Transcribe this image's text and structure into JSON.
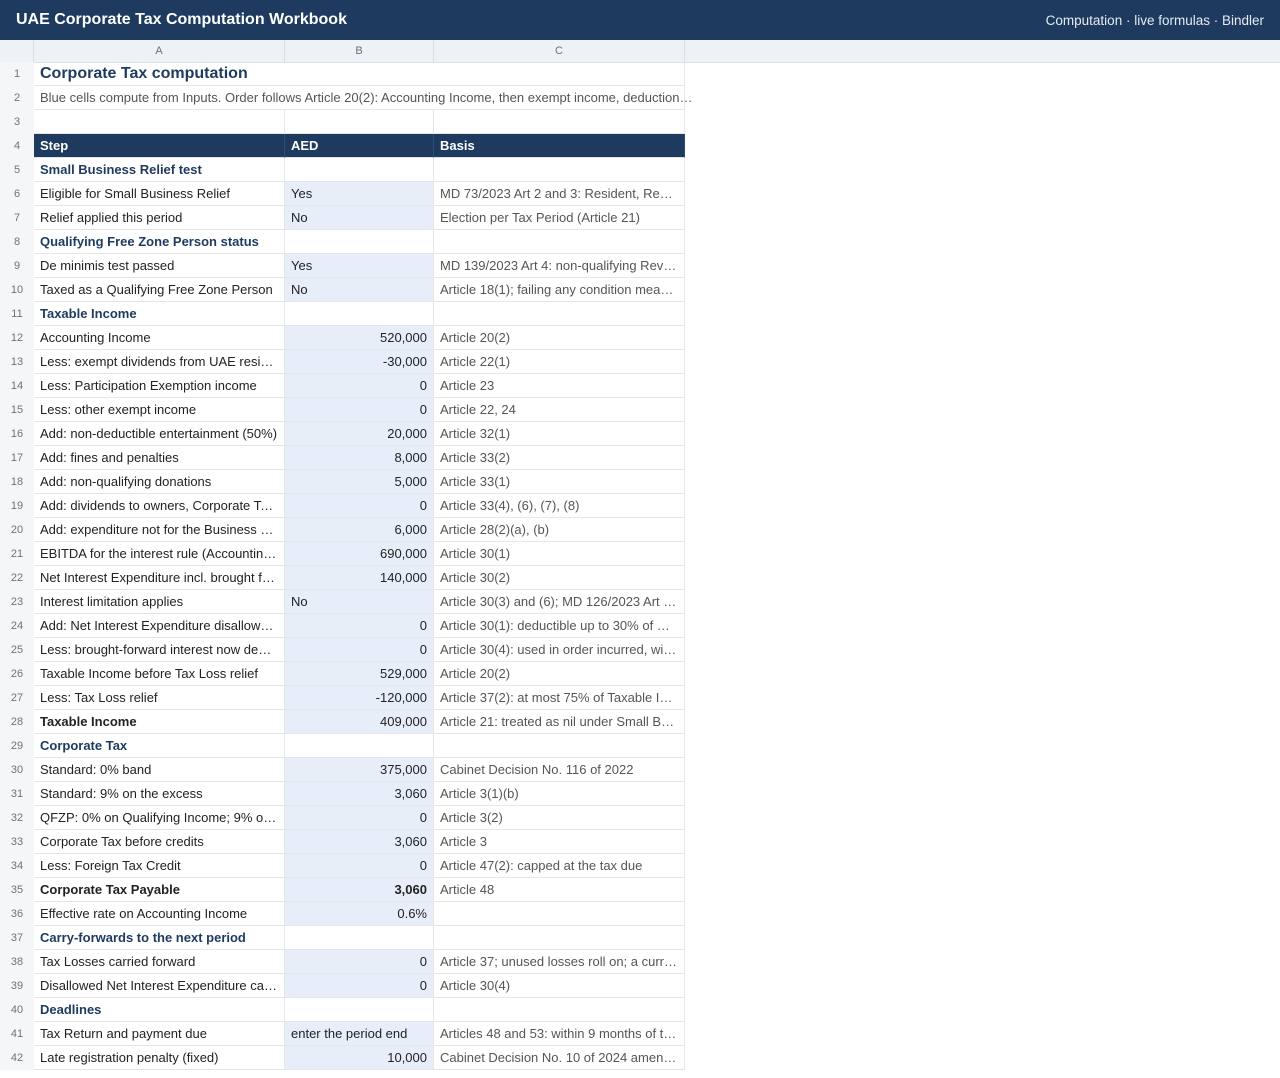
{
  "app": {
    "title": "UAE Corporate Tax Computation Workbook",
    "meta": "Computation · live formulas · Bindler"
  },
  "columns": [
    "A",
    "B",
    "C"
  ],
  "sheet": {
    "title": "Corporate Tax computation",
    "subtitle": "Blue cells compute from Inputs. Order follows Article 20(2): Accounting Income, then exempt income, deduction…",
    "header": {
      "step": "Step",
      "aed": "AED",
      "basis": "Basis"
    }
  },
  "rows": [
    {
      "n": "1",
      "kind": "title"
    },
    {
      "n": "2",
      "kind": "sub"
    },
    {
      "n": "3",
      "kind": "blank"
    },
    {
      "n": "4",
      "kind": "header"
    },
    {
      "n": "5",
      "kind": "section",
      "a": "Small Business Relief test"
    },
    {
      "n": "6",
      "kind": "data",
      "a": "Eligible for Small Business Relief",
      "b": "Yes",
      "c": "MD 73/2023 Art 2 and 3: Resident, Reve…"
    },
    {
      "n": "7",
      "kind": "data",
      "a": "Relief applied this period",
      "b": "No",
      "c": "Election per Tax Period (Article 21)"
    },
    {
      "n": "8",
      "kind": "section",
      "a": "Qualifying Free Zone Person status"
    },
    {
      "n": "9",
      "kind": "data",
      "a": "De minimis test passed",
      "b": "Yes",
      "c": "MD 139/2023 Art 4: non-qualifying Reve…"
    },
    {
      "n": "10",
      "kind": "data",
      "a": "Taxed as a Qualifying Free Zone Person",
      "b": "No",
      "c": "Article 18(1); failing any condition means…"
    },
    {
      "n": "11",
      "kind": "section",
      "a": "Taxable Income"
    },
    {
      "n": "12",
      "kind": "num",
      "a": "Accounting Income",
      "b": "520,000",
      "c": "Article 20(2)"
    },
    {
      "n": "13",
      "kind": "num",
      "a": "Less: exempt dividends from UAE resid…",
      "b": "-30,000",
      "c": "Article 22(1)"
    },
    {
      "n": "14",
      "kind": "num",
      "a": "Less: Participation Exemption income",
      "b": "0",
      "c": "Article 23"
    },
    {
      "n": "15",
      "kind": "num",
      "a": "Less: other exempt income",
      "b": "0",
      "c": "Article 22, 24"
    },
    {
      "n": "16",
      "kind": "num",
      "a": "Add: non-deductible entertainment (50%)",
      "b": "20,000",
      "c": "Article 32(1)"
    },
    {
      "n": "17",
      "kind": "num",
      "a": "Add: fines and penalties",
      "b": "8,000",
      "c": "Article 33(2)"
    },
    {
      "n": "18",
      "kind": "num",
      "a": "Add: non-qualifying donations",
      "b": "5,000",
      "c": "Article 33(1)"
    },
    {
      "n": "19",
      "kind": "num",
      "a": "Add: dividends to owners, Corporate Ta…",
      "b": "0",
      "c": "Article 33(4), (6), (7), (8)"
    },
    {
      "n": "20",
      "kind": "num",
      "a": "Add: expenditure not for the Business or…",
      "b": "6,000",
      "c": "Article 28(2)(a), (b)"
    },
    {
      "n": "21",
      "kind": "num",
      "a": "EBITDA for the interest rule (Accounting …",
      "b": "690,000",
      "c": "Article 30(1)"
    },
    {
      "n": "22",
      "kind": "num",
      "a": "Net Interest Expenditure incl. brought for…",
      "b": "140,000",
      "c": "Article 30(2)"
    },
    {
      "n": "23",
      "kind": "data",
      "a": "Interest limitation applies",
      "b": "No",
      "c": "Article 30(3) and (6); MD 126/2023 Art 8:…"
    },
    {
      "n": "24",
      "kind": "num",
      "a": "Add: Net Interest Expenditure disallowe…",
      "b": "0",
      "c": "Article 30(1): deductible up to 30% of E…"
    },
    {
      "n": "25",
      "kind": "num",
      "a": "Less: brought-forward interest now ded…",
      "b": "0",
      "c": "Article 30(4): used in order incurred, with…"
    },
    {
      "n": "26",
      "kind": "num",
      "a": "Taxable Income before Tax Loss relief",
      "b": "529,000",
      "c": "Article 20(2)"
    },
    {
      "n": "27",
      "kind": "num",
      "a": "Less: Tax Loss relief",
      "b": "-120,000",
      "c": "Article 37(2): at most 75% of Taxable Inc…"
    },
    {
      "n": "28",
      "kind": "num",
      "bold_a": true,
      "a": "Taxable Income",
      "b": "409,000",
      "c": "Article 21: treated as nil under Small Bu…"
    },
    {
      "n": "29",
      "kind": "section",
      "a": "Corporate Tax"
    },
    {
      "n": "30",
      "kind": "num",
      "a": "Standard: 0% band",
      "b": "375,000",
      "c": "Cabinet Decision No. 116 of 2022"
    },
    {
      "n": "31",
      "kind": "num",
      "a": "Standard: 9% on the excess",
      "b": "3,060",
      "c": "Article 3(1)(b)"
    },
    {
      "n": "32",
      "kind": "num",
      "a": "QFZP: 0% on Qualifying Income; 9% on…",
      "b": "0",
      "c": "Article 3(2)"
    },
    {
      "n": "33",
      "kind": "num",
      "a": "Corporate Tax before credits",
      "b": "3,060",
      "c": "Article 3"
    },
    {
      "n": "34",
      "kind": "num",
      "a": "Less: Foreign Tax Credit",
      "b": "0",
      "c": "Article 47(2): capped at the tax due"
    },
    {
      "n": "35",
      "kind": "num",
      "bold_a": true,
      "bold_b": true,
      "a": "Corporate Tax Payable",
      "b": "3,060",
      "c": "Article 48"
    },
    {
      "n": "36",
      "kind": "num",
      "a": "Effective rate on Accounting Income",
      "b": "0.6%",
      "c": ""
    },
    {
      "n": "37",
      "kind": "section",
      "a": "Carry-forwards to the next period"
    },
    {
      "n": "38",
      "kind": "num",
      "a": "Tax Losses carried forward",
      "b": "0",
      "c": "Article 37; unused losses roll on; a curre…"
    },
    {
      "n": "39",
      "kind": "num",
      "a": "Disallowed Net Interest Expenditure carr…",
      "b": "0",
      "c": "Article 30(4)"
    },
    {
      "n": "40",
      "kind": "section",
      "a": "Deadlines"
    },
    {
      "n": "41",
      "kind": "data",
      "a": "Tax Return and payment due",
      "b": "enter the period end",
      "c": "Articles 48 and 53: within 9 months of th…"
    },
    {
      "n": "42",
      "kind": "num",
      "a": "Late registration penalty (fixed)",
      "b": "10,000",
      "c": "Cabinet Decision No. 10 of 2024 amendi…"
    }
  ]
}
